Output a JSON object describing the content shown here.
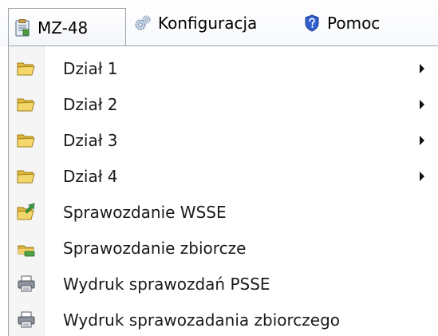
{
  "menubar": {
    "items": [
      {
        "label": "MZ-48",
        "icon": "clipboard-icon"
      },
      {
        "label": "Konfiguracja",
        "icon": "gears-icon"
      },
      {
        "label": "Pomoc",
        "icon": "help-shield-icon"
      }
    ]
  },
  "dropdown": {
    "items": [
      {
        "label": "Dział 1",
        "icon": "folder-open-icon",
        "submenu": true
      },
      {
        "label": "Dział 2",
        "icon": "folder-open-icon",
        "submenu": true
      },
      {
        "label": "Dział 3",
        "icon": "folder-open-icon",
        "submenu": true
      },
      {
        "label": "Dział 4",
        "icon": "folder-open-icon",
        "submenu": true
      },
      {
        "label": "Sprawozdanie WSSE",
        "icon": "folder-export-icon",
        "submenu": false
      },
      {
        "label": "Sprawozdanie zbiorcze",
        "icon": "folder-add-icon",
        "submenu": false
      },
      {
        "label": "Wydruk sprawozdań PSSE",
        "icon": "printer-icon",
        "submenu": false
      },
      {
        "label": "Wydruk sprawozadania zbiorczego",
        "icon": "printer-icon",
        "submenu": false
      }
    ]
  }
}
